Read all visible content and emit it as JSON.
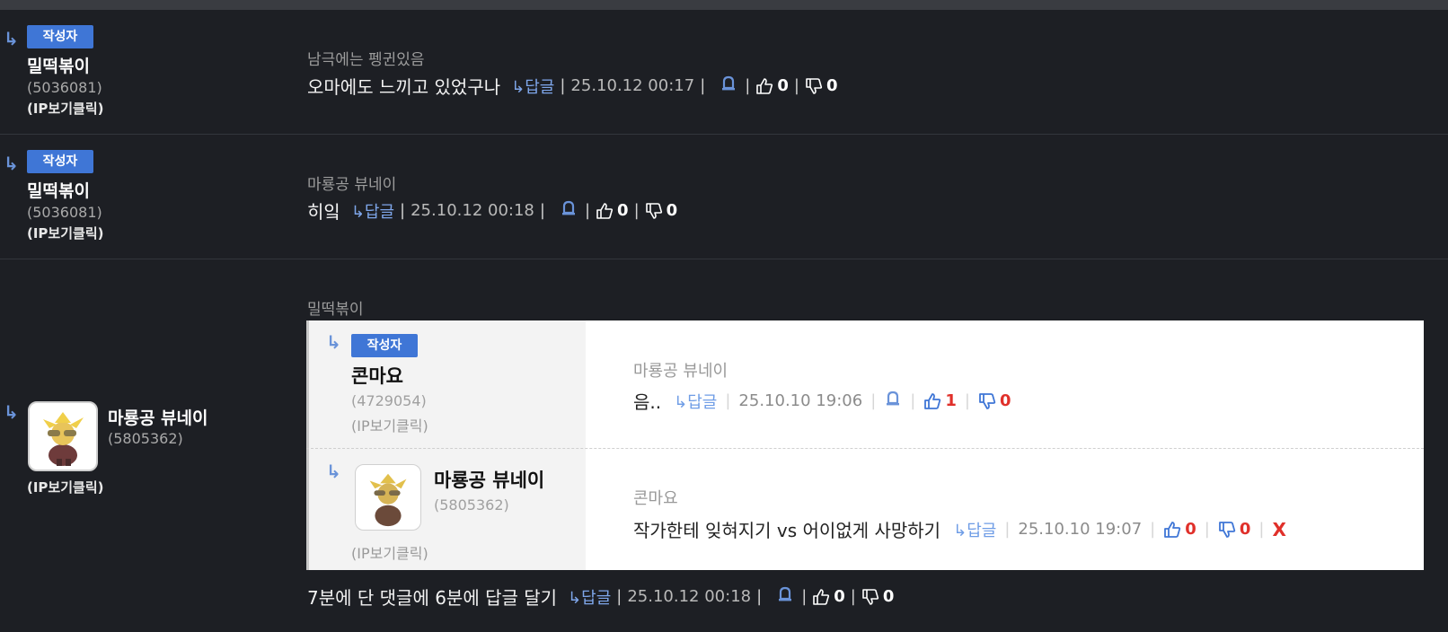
{
  "comments": [
    {
      "badge": "작성자",
      "username": "밀떡볶이",
      "user_id": "(5036081)",
      "ip_label": "(IP보기클릭)",
      "reply_target": "남극에는 펭귄있음",
      "text": "오마에도 느끼고 있었구나",
      "reply_label": "답글",
      "date": "25.10.12 00:17",
      "likes": "0",
      "dislikes": "0"
    },
    {
      "badge": "작성자",
      "username": "밀떡볶이",
      "user_id": "(5036081)",
      "ip_label": "(IP보기클릭)",
      "reply_target": "마룡공 뷰네이",
      "text": "히잌",
      "reply_label": "답글",
      "date": "25.10.12 00:18",
      "likes": "0",
      "dislikes": "0"
    },
    {
      "username": "마룡공 뷰네이",
      "user_id": "(5805362)",
      "ip_label": "(IP보기클릭)",
      "reply_target": "밀떡볶이",
      "text": "7분에 단 댓글에 6분에 답글 달기",
      "reply_label": "답글",
      "date": "25.10.12 00:18",
      "likes": "0",
      "dislikes": "0",
      "quoted": [
        {
          "badge": "작성자",
          "username": "콘마요",
          "user_id": "(4729054)",
          "ip_label": "(IP보기클릭)",
          "reply_target": "마룡공 뷰네이",
          "text": "음..",
          "reply_label": "답글",
          "date": "25.10.10 19:06",
          "likes": "1",
          "dislikes": "0"
        },
        {
          "username": "마룡공 뷰네이",
          "user_id": "(5805362)",
          "ip_label": "(IP보기클릭)",
          "reply_target": "콘마요",
          "text": "작가한테 잊혀지기 vs 어이없게 사망하기",
          "reply_label": "답글",
          "date": "25.10.10 19:07",
          "likes": "0",
          "dislikes": "0",
          "delete_label": "X"
        }
      ]
    }
  ],
  "colors": {
    "accent": "#3f76d6",
    "reply_link": "#7ea6ea",
    "danger": "#e0302a",
    "background": "#1d1f24"
  },
  "icons": [
    "reply-arrow-icon",
    "bell-icon",
    "thumbs-up-icon",
    "thumbs-down-icon",
    "avatar-icon"
  ]
}
